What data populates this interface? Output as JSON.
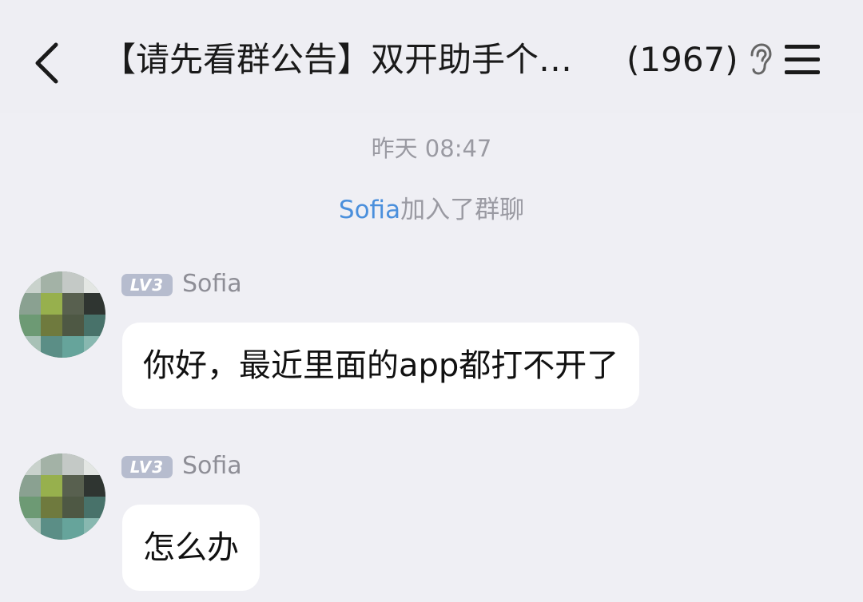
{
  "header": {
    "back_icon": "chevron-left-icon",
    "title": "【请先看群公告】双开助手个…",
    "member_count": "(1967)",
    "ear_icon": "ear-icon",
    "menu_icon": "hamburger-menu-icon"
  },
  "chat": {
    "timestamp": "昨天 08:47",
    "system_notice": {
      "name": "Sofia",
      "text": "加入了群聊",
      "name_color": "#4a8fdc"
    },
    "messages": [
      {
        "level": "LV3",
        "sender": "Sofia",
        "text": "你好，最近里面的app都打不开了"
      },
      {
        "level": "LV3",
        "sender": "Sofia",
        "text": "怎么办"
      }
    ]
  },
  "colors": {
    "background": "#efeff4",
    "bubble": "#ffffff",
    "badge": "#b6bcce",
    "link": "#4a8fdc"
  }
}
